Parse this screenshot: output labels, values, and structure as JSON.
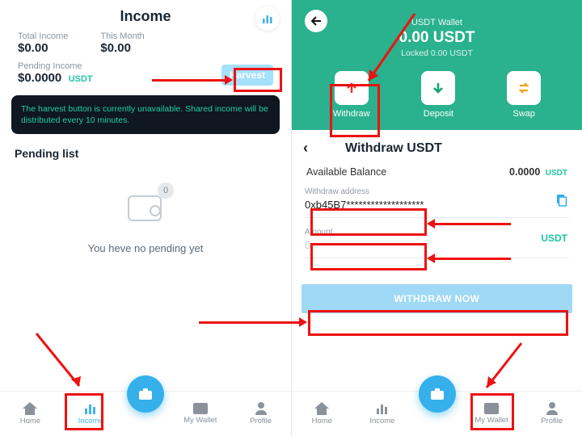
{
  "left": {
    "title": "Income",
    "total_label": "Total Income",
    "total_value": "$0.00",
    "month_label": "This Month",
    "month_value": "$0.00",
    "pending_label": "Pending Income",
    "pending_value": "$0.0000",
    "pending_unit": "USDT",
    "harvest_btn": "Harvest",
    "notice": "The harvest button is currently unavailable. Shared income will be distributed every 10 minutes.",
    "pending_list_title": "Pending list",
    "empty_badge": "0",
    "empty_text": "You heve no pending yet",
    "nav": {
      "home": "Home",
      "income": "Income",
      "wallet": "My Wallet",
      "profile": "Profile"
    }
  },
  "right": {
    "wallet_label": "USDT Wallet",
    "wallet_balance": "0.00 USDT",
    "wallet_locked": "Locked 0.00 USDT",
    "actions": {
      "withdraw": "Withdraw",
      "deposit": "Deposit",
      "swap": "Swap"
    },
    "wd_title": "Withdraw USDT",
    "avail_label": "Available Balance",
    "avail_value": "0.0000",
    "avail_unit": "USDT",
    "addr_label": "Withdraw address",
    "addr_value": "0xb45B7*******************",
    "amount_label": "Amount",
    "amount_placeholder": "0",
    "amount_unit": "USDT",
    "wd_now": "WITHDRAW NOW",
    "nav": {
      "home": "Home",
      "income": "Income",
      "wallet": "My Wallet",
      "profile": "Profile"
    }
  },
  "colors": {
    "accent": "#36b0eb",
    "green": "#2ab18d",
    "teal": "#1ec6a4",
    "anno": "#e11"
  }
}
